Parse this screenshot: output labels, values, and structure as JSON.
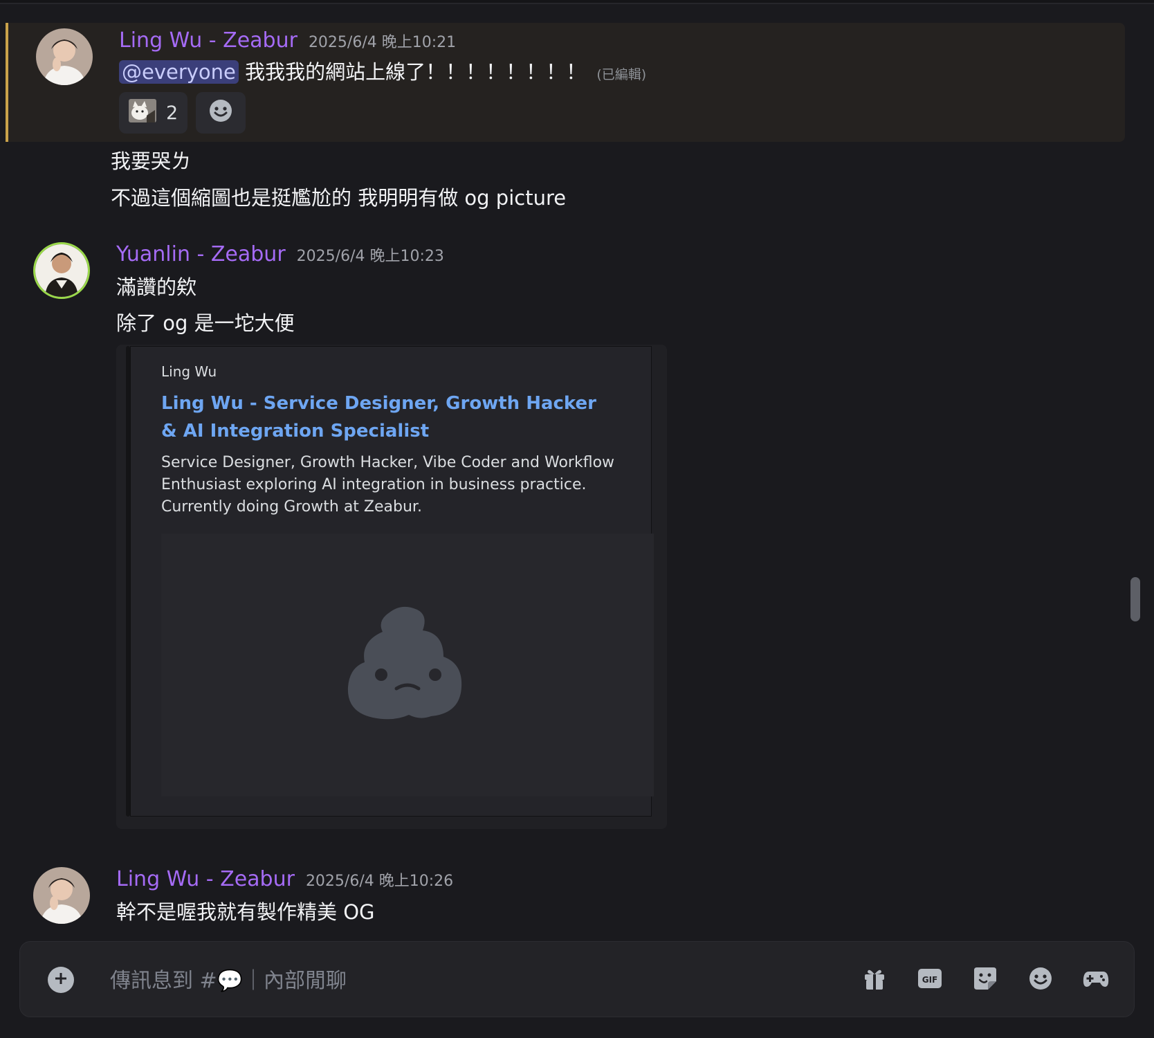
{
  "messages": [
    {
      "author": "Ling Wu - Zeabur",
      "timestamp": "2025/6/4 晚上10:21",
      "mention": "@everyone",
      "text": "我我我的網站上線了！！！！！！！！",
      "edited": "(已編輯)",
      "reactions": [
        {
          "emoji": "cat-photo-emoji",
          "count": "2"
        }
      ]
    },
    {
      "continuation_lines": [
        "我要哭ㄌ",
        "不過這個縮圖也是挺尷尬的 我明明有做 og picture"
      ]
    },
    {
      "author": "Yuanlin - Zeabur",
      "timestamp": "2025/6/4 晚上10:23",
      "lines": [
        "滿讚的欸",
        "除了 og 是一坨大便"
      ],
      "embed": {
        "provider": "Ling Wu",
        "title": "Ling Wu - Service Designer, Growth Hacker & AI Integration Specialist",
        "description": "Service Designer, Growth Hacker, Vibe Coder and Workflow Enthusiast exploring AI integration in business practice. Currently doing Growth at Zeabur.",
        "image_icon": "poop-icon"
      }
    },
    {
      "author": "Ling Wu - Zeabur",
      "timestamp": "2025/6/4 晚上10:26",
      "lines": [
        "幹不是喔我就有製作精美 OG"
      ]
    }
  ],
  "composer": {
    "placeholder": "傳訊息到 #💬｜內部閒聊"
  },
  "toolbar_icons": [
    "gift-icon",
    "gif-icon",
    "sticker-icon",
    "emoji-icon",
    "gamepad-icon"
  ],
  "colors": {
    "background": "#1a1a1e",
    "author": "#a56bf5",
    "link": "#6ea6f2",
    "highlight_bar": "#c9a24a",
    "mention_bg": "#3b3f7a"
  }
}
